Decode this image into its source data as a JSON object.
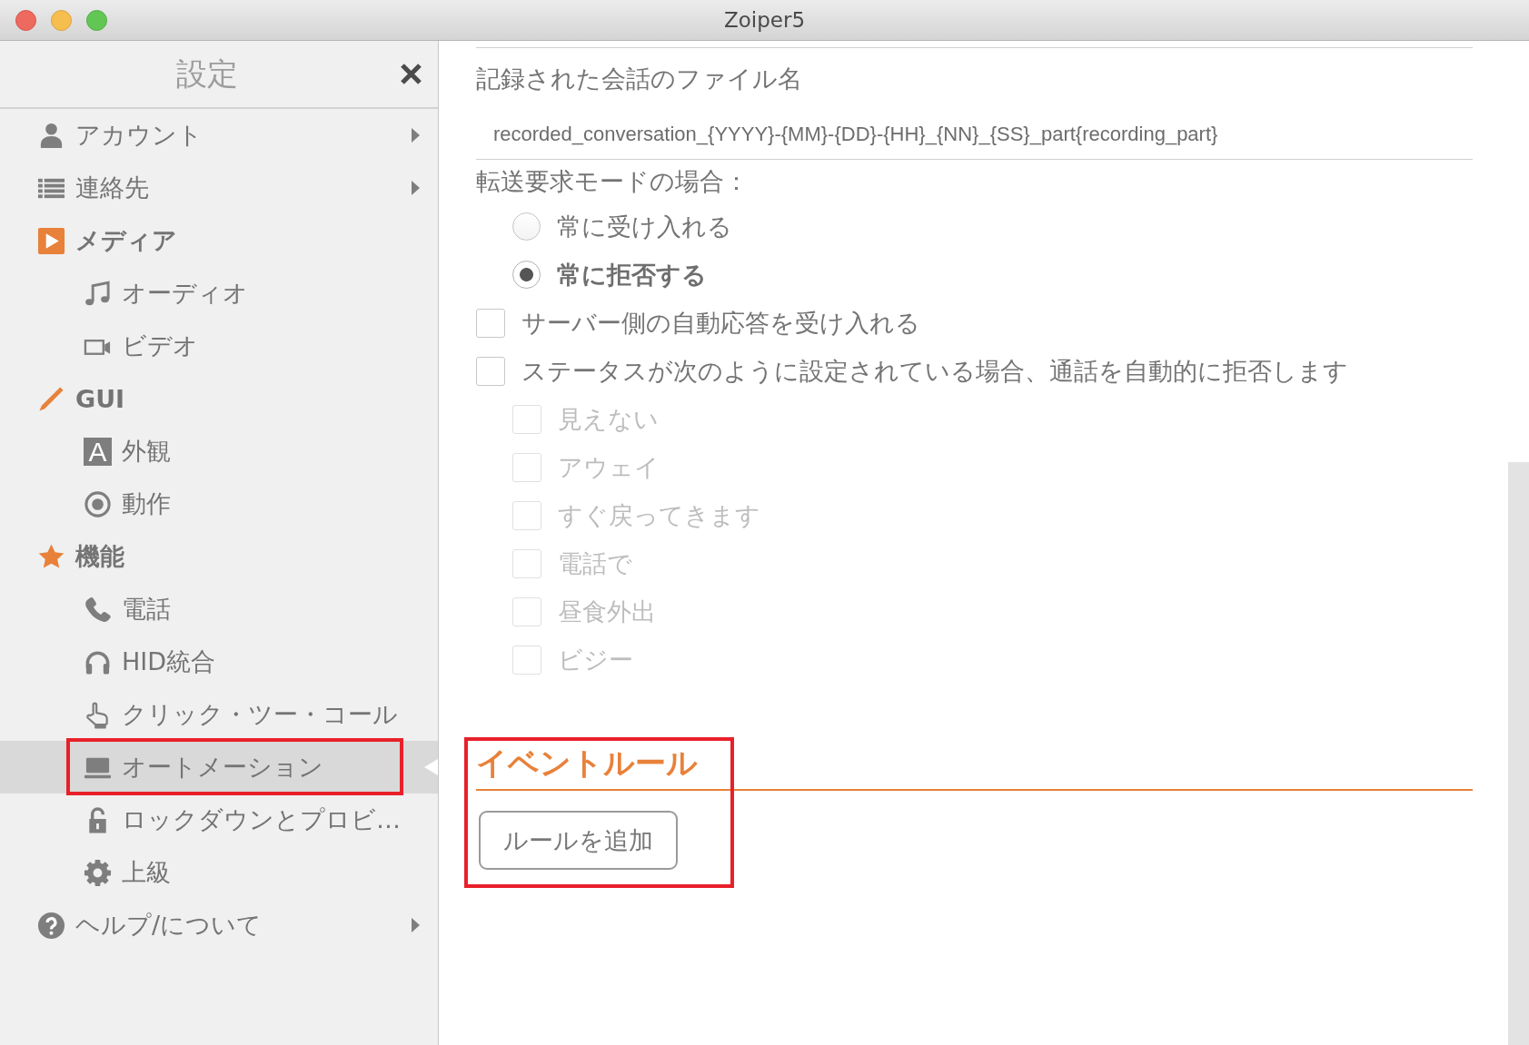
{
  "window": {
    "title": "Zoiper5"
  },
  "sidebar": {
    "title": "設定",
    "items": [
      {
        "label": "アカウント",
        "expanded": false,
        "selected": false,
        "highlighted": false
      },
      {
        "label": "連絡先",
        "expanded": false,
        "selected": false,
        "highlighted": false
      },
      {
        "label": "メディア",
        "expanded": true,
        "selected": false,
        "highlighted": false,
        "children": [
          {
            "label": "オーディオ",
            "selected": false,
            "highlighted": false
          },
          {
            "label": "ビデオ",
            "selected": false,
            "highlighted": false
          }
        ]
      },
      {
        "label": "GUI",
        "expanded": true,
        "selected": false,
        "highlighted": false,
        "children": [
          {
            "label": "外観",
            "glyph": "A",
            "selected": false,
            "highlighted": false
          },
          {
            "label": "動作",
            "selected": false,
            "highlighted": false
          }
        ]
      },
      {
        "label": "機能",
        "expanded": true,
        "selected": false,
        "highlighted": false,
        "children": [
          {
            "label": "電話",
            "selected": false,
            "highlighted": false
          },
          {
            "label": "HID統合",
            "selected": false,
            "highlighted": false
          },
          {
            "label": "クリック・ツー・コール",
            "selected": false,
            "highlighted": false
          },
          {
            "label": "オートメーション",
            "selected": true,
            "highlighted": true
          },
          {
            "label": "ロックダウンとプロビ…",
            "selected": false,
            "highlighted": false
          },
          {
            "label": "上級",
            "selected": false,
            "highlighted": false
          }
        ]
      },
      {
        "label": "ヘルプ/について",
        "expanded": false,
        "selected": false,
        "highlighted": false
      }
    ]
  },
  "recording_filename": {
    "label": "記録された会話のファイル名",
    "value": "recorded_conversation_{YYYY}-{MM}-{DD}-{HH}_{NN}_{SS}_part{recording_part}"
  },
  "transfer_request_mode": {
    "label": "転送要求モードの場合：",
    "options": [
      {
        "label": "常に受け入れる",
        "selected": false
      },
      {
        "label": "常に拒否する",
        "selected": true
      }
    ]
  },
  "checkboxes": [
    {
      "label": "サーバー側の自動応答を受け入れる",
      "checked": false
    },
    {
      "label": "ステータスが次のように設定されている場合、通話を自動的に拒否します",
      "checked": false,
      "children": [
        {
          "label": "見えない",
          "checked": false,
          "disabled": true
        },
        {
          "label": "アウェイ",
          "checked": false,
          "disabled": true
        },
        {
          "label": "すぐ戻ってきます",
          "checked": false,
          "disabled": true
        },
        {
          "label": "電話で",
          "checked": false,
          "disabled": true
        },
        {
          "label": "昼食外出",
          "checked": false,
          "disabled": true
        },
        {
          "label": "ビジー",
          "checked": false,
          "disabled": true
        }
      ]
    }
  ],
  "event_rules": {
    "title": "イベントルール",
    "highlighted": true,
    "button": "ルールを追加"
  }
}
